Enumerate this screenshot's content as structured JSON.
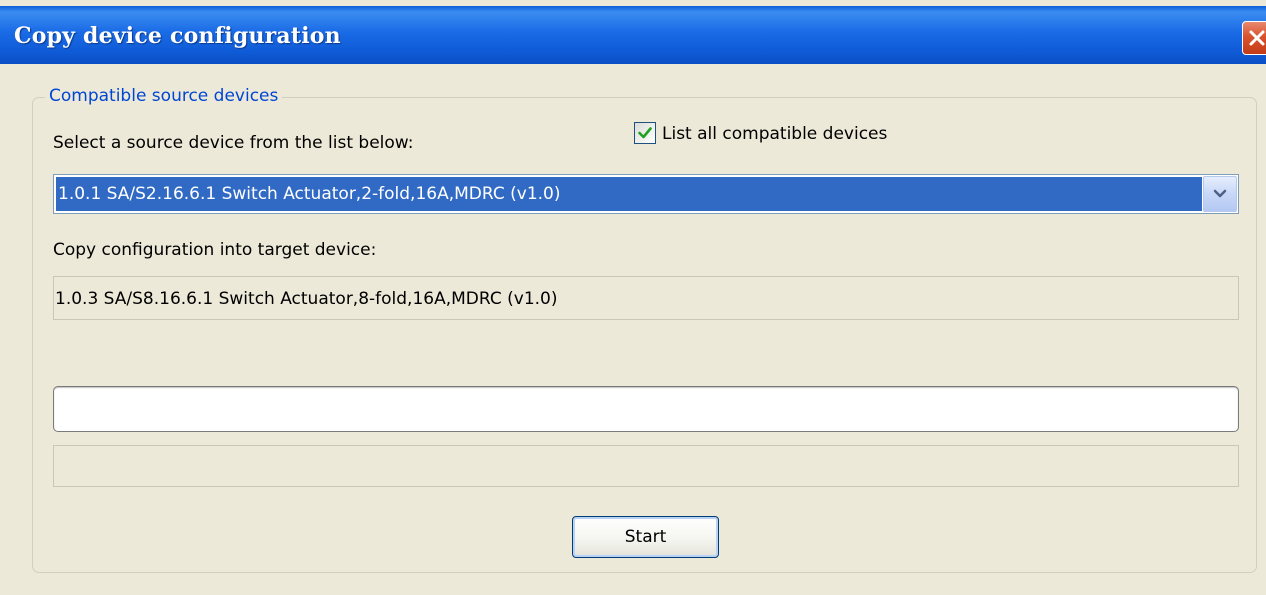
{
  "window": {
    "title": "Copy device configuration"
  },
  "group": {
    "legend": "Compatible source devices"
  },
  "source": {
    "select_label": "Select a source device from the list below:",
    "list_all_label": "List all compatible devices",
    "list_all_checked": true,
    "selected_device": "1.0.1 SA/S2.16.6.1 Switch Actuator,2-fold,16A,MDRC (v1.0)"
  },
  "target": {
    "label": "Copy configuration into target device:",
    "device": "1.0.3 SA/S8.16.6.1 Switch Actuator,8-fold,16A,MDRC (v1.0)"
  },
  "status": {
    "value": "",
    "progress": 0
  },
  "actions": {
    "start_label": "Start"
  },
  "icons": {
    "close": "close-icon",
    "checkmark": "checkmark-icon",
    "dropdown": "chevron-down-icon"
  },
  "colors": {
    "titlebar": "#0f5ad6",
    "selection": "#316ac5",
    "legend": "#0046d5",
    "checkmark": "#21a121",
    "close": "#d9532e"
  }
}
